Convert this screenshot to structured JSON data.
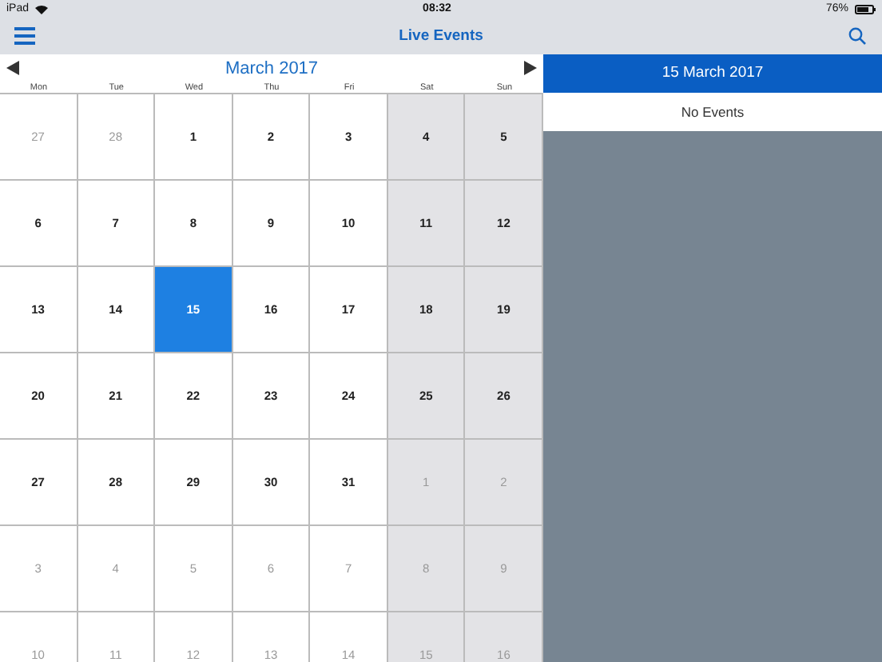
{
  "status_bar": {
    "device": "iPad",
    "time": "08:32",
    "battery": "76%"
  },
  "nav_bar": {
    "title": "Live Events"
  },
  "calendar": {
    "month": "March 2017",
    "weekdays": [
      "Mon",
      "Tue",
      "Wed",
      "Thu",
      "Fri",
      "Sat",
      "Sun"
    ],
    "weeks": [
      [
        {
          "day": "27",
          "in_month": false,
          "selected": false
        },
        {
          "day": "28",
          "in_month": false,
          "selected": false
        },
        {
          "day": "1",
          "in_month": true,
          "selected": false
        },
        {
          "day": "2",
          "in_month": true,
          "selected": false
        },
        {
          "day": "3",
          "in_month": true,
          "selected": false
        },
        {
          "day": "4",
          "in_month": true,
          "selected": false
        },
        {
          "day": "5",
          "in_month": true,
          "selected": false
        }
      ],
      [
        {
          "day": "6",
          "in_month": true,
          "selected": false
        },
        {
          "day": "7",
          "in_month": true,
          "selected": false
        },
        {
          "day": "8",
          "in_month": true,
          "selected": false
        },
        {
          "day": "9",
          "in_month": true,
          "selected": false
        },
        {
          "day": "10",
          "in_month": true,
          "selected": false
        },
        {
          "day": "11",
          "in_month": true,
          "selected": false
        },
        {
          "day": "12",
          "in_month": true,
          "selected": false
        }
      ],
      [
        {
          "day": "13",
          "in_month": true,
          "selected": false
        },
        {
          "day": "14",
          "in_month": true,
          "selected": false
        },
        {
          "day": "15",
          "in_month": true,
          "selected": true
        },
        {
          "day": "16",
          "in_month": true,
          "selected": false
        },
        {
          "day": "17",
          "in_month": true,
          "selected": false
        },
        {
          "day": "18",
          "in_month": true,
          "selected": false
        },
        {
          "day": "19",
          "in_month": true,
          "selected": false
        }
      ],
      [
        {
          "day": "20",
          "in_month": true,
          "selected": false
        },
        {
          "day": "21",
          "in_month": true,
          "selected": false
        },
        {
          "day": "22",
          "in_month": true,
          "selected": false
        },
        {
          "day": "23",
          "in_month": true,
          "selected": false
        },
        {
          "day": "24",
          "in_month": true,
          "selected": false
        },
        {
          "day": "25",
          "in_month": true,
          "selected": false
        },
        {
          "day": "26",
          "in_month": true,
          "selected": false
        }
      ],
      [
        {
          "day": "27",
          "in_month": true,
          "selected": false
        },
        {
          "day": "28",
          "in_month": true,
          "selected": false
        },
        {
          "day": "29",
          "in_month": true,
          "selected": false
        },
        {
          "day": "30",
          "in_month": true,
          "selected": false
        },
        {
          "day": "31",
          "in_month": true,
          "selected": false
        },
        {
          "day": "1",
          "in_month": false,
          "selected": false
        },
        {
          "day": "2",
          "in_month": false,
          "selected": false
        }
      ],
      [
        {
          "day": "3",
          "in_month": false,
          "selected": false
        },
        {
          "day": "4",
          "in_month": false,
          "selected": false
        },
        {
          "day": "5",
          "in_month": false,
          "selected": false
        },
        {
          "day": "6",
          "in_month": false,
          "selected": false
        },
        {
          "day": "7",
          "in_month": false,
          "selected": false
        },
        {
          "day": "8",
          "in_month": false,
          "selected": false
        },
        {
          "day": "9",
          "in_month": false,
          "selected": false
        }
      ],
      [
        {
          "day": "10",
          "in_month": false,
          "selected": false
        },
        {
          "day": "11",
          "in_month": false,
          "selected": false
        },
        {
          "day": "12",
          "in_month": false,
          "selected": false
        },
        {
          "day": "13",
          "in_month": false,
          "selected": false
        },
        {
          "day": "14",
          "in_month": false,
          "selected": false
        },
        {
          "day": "15",
          "in_month": false,
          "selected": false
        },
        {
          "day": "16",
          "in_month": false,
          "selected": false
        }
      ]
    ]
  },
  "events_panel": {
    "date": "15 March 2017",
    "message": "No Events"
  }
}
